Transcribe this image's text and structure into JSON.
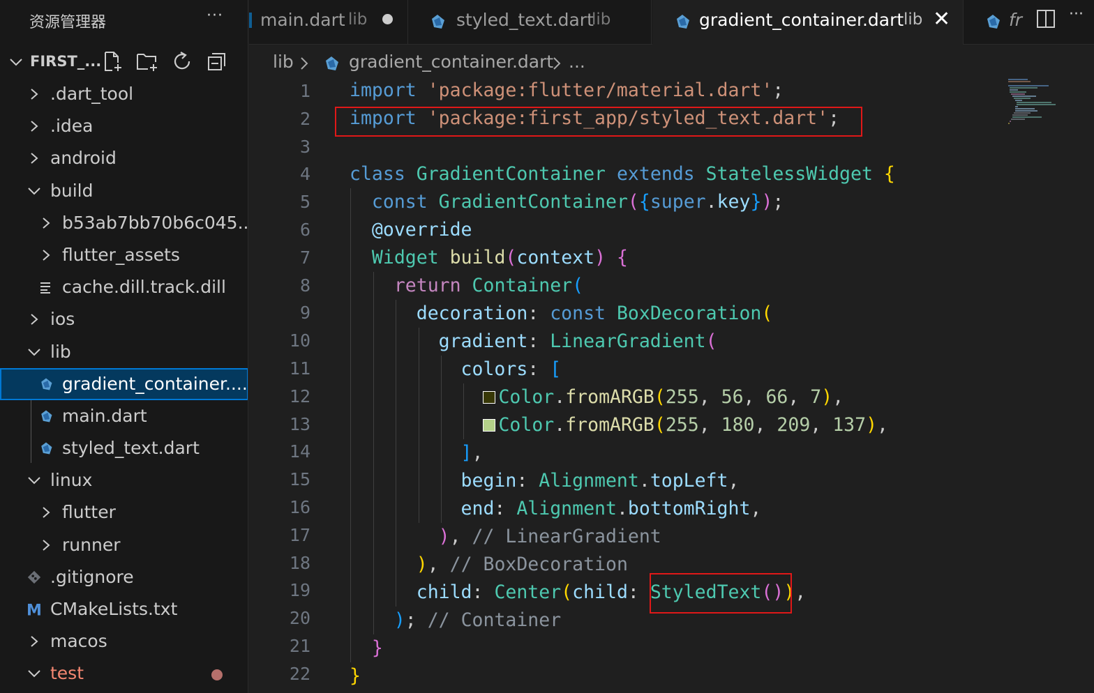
{
  "sidebar": {
    "title": "资源管理器",
    "more": "···",
    "project_name": "FIRST_...",
    "tree": [
      {
        "label": ".dart_tool",
        "kind": "folder",
        "open": false,
        "depth": 0
      },
      {
        "label": ".idea",
        "kind": "folder",
        "open": false,
        "depth": 0
      },
      {
        "label": "android",
        "kind": "folder",
        "open": false,
        "depth": 0
      },
      {
        "label": "build",
        "kind": "folder",
        "open": true,
        "depth": 0
      },
      {
        "label": "b53ab7bb70b6c045...",
        "kind": "folder",
        "open": false,
        "depth": 1
      },
      {
        "label": "flutter_assets",
        "kind": "folder",
        "open": false,
        "depth": 1
      },
      {
        "label": "cache.dill.track.dill",
        "kind": "file-lines",
        "depth": 1
      },
      {
        "label": "ios",
        "kind": "folder",
        "open": false,
        "depth": 0
      },
      {
        "label": "lib",
        "kind": "folder",
        "open": true,
        "depth": 0
      },
      {
        "label": "gradient_container....",
        "kind": "dart",
        "depth": 1,
        "selected": true
      },
      {
        "label": "main.dart",
        "kind": "dart",
        "depth": 1
      },
      {
        "label": "styled_text.dart",
        "kind": "dart",
        "depth": 1
      },
      {
        "label": "linux",
        "kind": "folder",
        "open": true,
        "depth": 0
      },
      {
        "label": "flutter",
        "kind": "folder",
        "open": false,
        "depth": 1
      },
      {
        "label": "runner",
        "kind": "folder",
        "open": false,
        "depth": 1
      },
      {
        "label": ".gitignore",
        "kind": "git",
        "depth": 0
      },
      {
        "label": "CMakeLists.txt",
        "kind": "cmake",
        "depth": 0
      },
      {
        "label": "macos",
        "kind": "folder",
        "open": false,
        "depth": 0
      },
      {
        "label": "test",
        "kind": "folder",
        "open": true,
        "depth": 0,
        "modified": true
      }
    ]
  },
  "tabs": [
    {
      "name": "main.dart",
      "desc": "lib",
      "dirty": true
    },
    {
      "name": "styled_text.dart",
      "desc": "lib"
    },
    {
      "name": "gradient_container.dart",
      "desc": "lib",
      "active": true,
      "close": "✕"
    },
    {
      "name": "fr"
    }
  ],
  "breadcrumb": {
    "folder": "lib",
    "file": "gradient_container.dart",
    "symbol": "..."
  },
  "editor": {
    "line_numbers": [
      "1",
      "2",
      "3",
      "4",
      "5",
      "6",
      "7",
      "8",
      "9",
      "10",
      "11",
      "12",
      "13",
      "14",
      "15",
      "16",
      "17",
      "18",
      "19",
      "20",
      "21",
      "22"
    ]
  },
  "colors": {
    "accent": "#0078d4",
    "highlight_box": "#e01818",
    "swatch_1": "#383807",
    "swatch_2": "#b4d189"
  }
}
